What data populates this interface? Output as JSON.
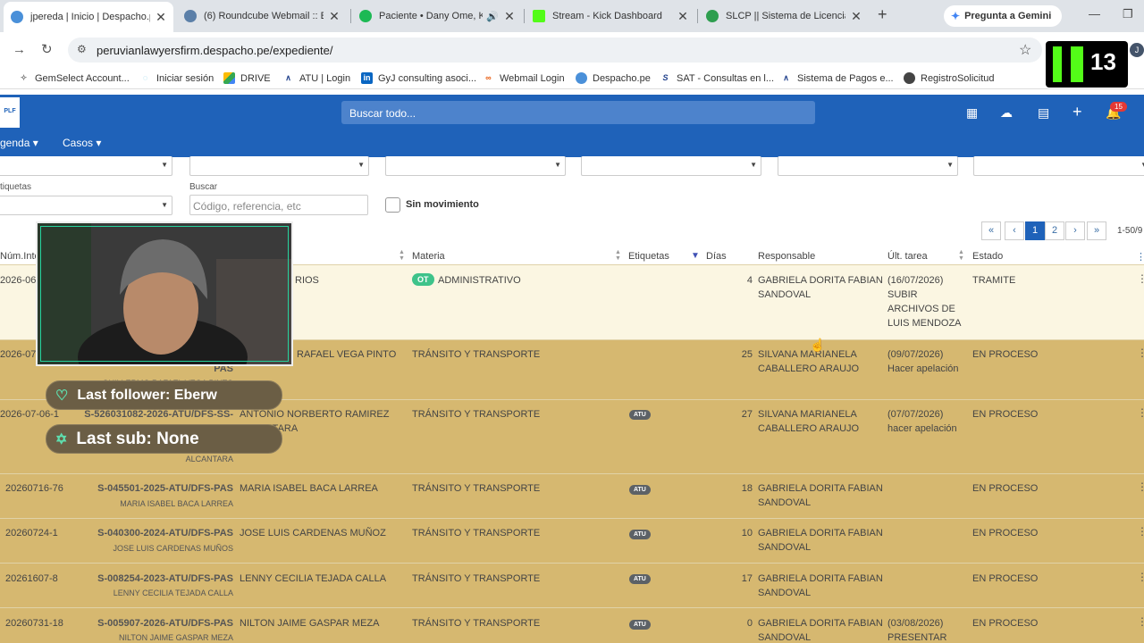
{
  "tabs": [
    {
      "title": "jpereda | Inicio | Despacho.pe",
      "fav_color": "#4a90d9"
    },
    {
      "title": "(6) Roundcube Webmail :: Er",
      "fav_color": "#5b7fa8"
    },
    {
      "title": "Paciente • Dany Ome, Kc",
      "fav_color": "#1db954"
    },
    {
      "title": "Stream - Kick Dashboard",
      "fav_color": "#53fc18"
    },
    {
      "title": "SLCP || Sistema de Licencias",
      "fav_color": "#2e9e4f"
    }
  ],
  "gemini_label": "Pregunta a Gemini",
  "url": "peruvianlawyersfirm.despacho.pe/expediente/",
  "bookmarks": [
    "GemSelect Account...",
    "Iniciar sesión",
    "DRIVE",
    "ATU | Login",
    "GyJ consulting asoci...",
    "Webmail Login",
    "Despacho.pe",
    "SAT - Consultas en l...",
    "Sistema de Pagos e...",
    "RegistroSolicitud"
  ],
  "kick_count": "13",
  "profile_initial": "J",
  "app": {
    "logo_text": "PLF",
    "search_placeholder": "Buscar todo...",
    "notifications": "15",
    "menu": [
      "genda",
      "Casos"
    ]
  },
  "filters": {
    "etiquetas_label": "tiquetas",
    "buscar_label": "Buscar",
    "buscar_placeholder": "Código, referencia, etc",
    "sin_movimiento": "Sin movimiento"
  },
  "pagination": {
    "pages": [
      "1",
      "2"
    ],
    "info": "1-50/9"
  },
  "columns": {
    "num": "Núm.Inte",
    "materia": "Materia",
    "etiquetas": "Etiquetas",
    "dias": "Días",
    "responsable": "Responsable",
    "ult_tarea": "Últ. tarea",
    "estado": "Estado"
  },
  "rows": [
    {
      "num": "2026-06",
      "ref": "",
      "ref_sub": "",
      "cliente": "RIOS",
      "materia": "ADMINISTRATIVO",
      "tag": "OT",
      "dias": "4",
      "responsable": "GABRIELA DORITA FABIAN SANDOVAL",
      "ult_tarea": "(16/07/2026) SUBIR ARCHIVOS DE LUIS MENDOZA",
      "estado": "TRAMITE"
    },
    {
      "num": "2026-07",
      "ref": "PAS",
      "ref_sub": "GUILLERMO RAFAEL VEGA PINTO",
      "cliente": "RAFAEL VEGA PINTO",
      "materia": "TRÁNSITO Y TRANSPORTE",
      "tag": "",
      "dias": "25",
      "responsable": "SILVANA MARIANELA CABALLERO ARAUJO",
      "ult_tarea": "(09/07/2026) Hacer apelación",
      "estado": "EN PROCESO"
    },
    {
      "num": "2026-07-06-1",
      "ref": "S-526031082-2026-ATU/DFS-SS-",
      "ref_sub": "ALCANTARA",
      "cliente": "ANTONIO NORBERTO RAMIREZ ALCANTARA",
      "materia": "TRÁNSITO Y TRANSPORTE",
      "tag": "ATU",
      "dias": "27",
      "responsable": "SILVANA MARIANELA CABALLERO ARAUJO",
      "ult_tarea": "(07/07/2026) hacer apelación",
      "estado": "EN PROCESO"
    },
    {
      "num": "20260716-76",
      "ref": "S-045501-2025-ATU/DFS-PAS",
      "ref_sub": "MARIA ISABEL BACA LARREA",
      "cliente": "MARIA ISABEL BACA LARREA",
      "materia": "TRÁNSITO Y TRANSPORTE",
      "tag": "ATU",
      "dias": "18",
      "responsable": "GABRIELA DORITA FABIAN SANDOVAL",
      "ult_tarea": "",
      "estado": "EN PROCESO"
    },
    {
      "num": "20260724-1",
      "ref": "S-040300-2024-ATU/DFS-PAS",
      "ref_sub": "JOSE LUIS CARDENAS MUÑOS",
      "cliente": "JOSE LUIS CARDENAS MUÑOZ",
      "materia": "TRÁNSITO Y TRANSPORTE",
      "tag": "ATU",
      "dias": "10",
      "responsable": "GABRIELA DORITA FABIAN SANDOVAL",
      "ult_tarea": "",
      "estado": "EN PROCESO"
    },
    {
      "num": "20261607-8",
      "ref": "S-008254-2023-ATU/DFS-PAS",
      "ref_sub": "LENNY CECILIA TEJADA CALLA",
      "cliente": "LENNY CECILIA TEJADA CALLA",
      "materia": "TRÁNSITO Y TRANSPORTE",
      "tag": "ATU",
      "dias": "17",
      "responsable": "GABRIELA DORITA FABIAN SANDOVAL",
      "ult_tarea": "",
      "estado": "EN PROCESO"
    },
    {
      "num": "20260731-18",
      "ref": "S-005907-2026-ATU/DFS-PAS",
      "ref_sub": "NILTON JAIME GASPAR MEZA",
      "cliente": "NILTON JAIME GASPAR MEZA",
      "materia": "TRÁNSITO Y TRANSPORTE",
      "tag": "ATU",
      "dias": "0",
      "responsable": "GABRIELA DORITA FABIAN SANDOVAL",
      "ult_tarea": "(03/08/2026) PRESENTAR",
      "estado": "EN PROCESO"
    }
  ],
  "overlay": {
    "last_follower": "Last follower: Eberw",
    "last_sub": "Last sub: None"
  }
}
